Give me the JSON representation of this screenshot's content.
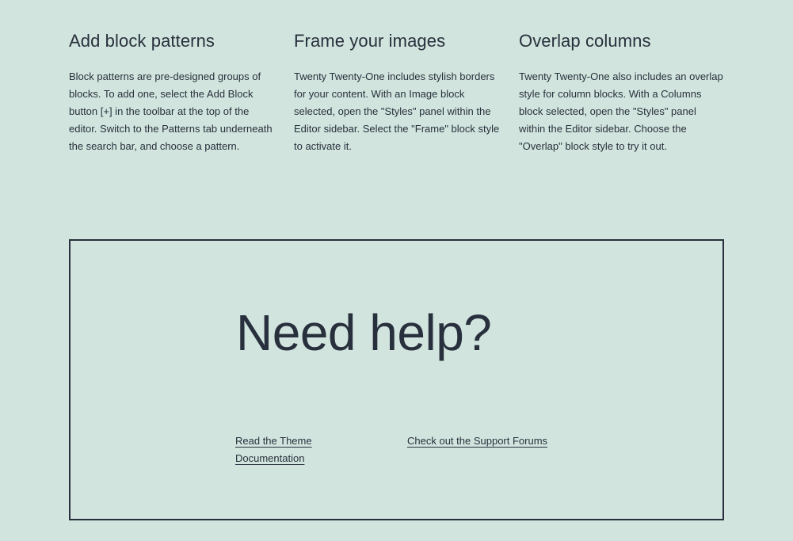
{
  "features": [
    {
      "title": "Add block patterns",
      "body": "Block patterns are pre-designed groups of blocks. To add one, select the Add Block button [+] in the toolbar at the top of the editor. Switch to the Patterns tab underneath the search bar, and choose a pattern."
    },
    {
      "title": "Frame your images",
      "body": "Twenty Twenty-One includes stylish borders for your content. With an Image block selected, open the \"Styles\" panel within the Editor sidebar. Select the \"Frame\" block style to activate it."
    },
    {
      "title": "Overlap columns",
      "body": "Twenty Twenty-One also includes an overlap style for column blocks. With a Columns block selected, open the \"Styles\" panel within the Editor sidebar. Choose the \"Overlap\" block style to try it out."
    }
  ],
  "help": {
    "title": "Need help?",
    "links": [
      {
        "label": "Read the Theme Documentation"
      },
      {
        "label": "Check out the Support Forums"
      }
    ]
  },
  "colors": {
    "background": "#d1e4dd",
    "text": "#28303d"
  }
}
